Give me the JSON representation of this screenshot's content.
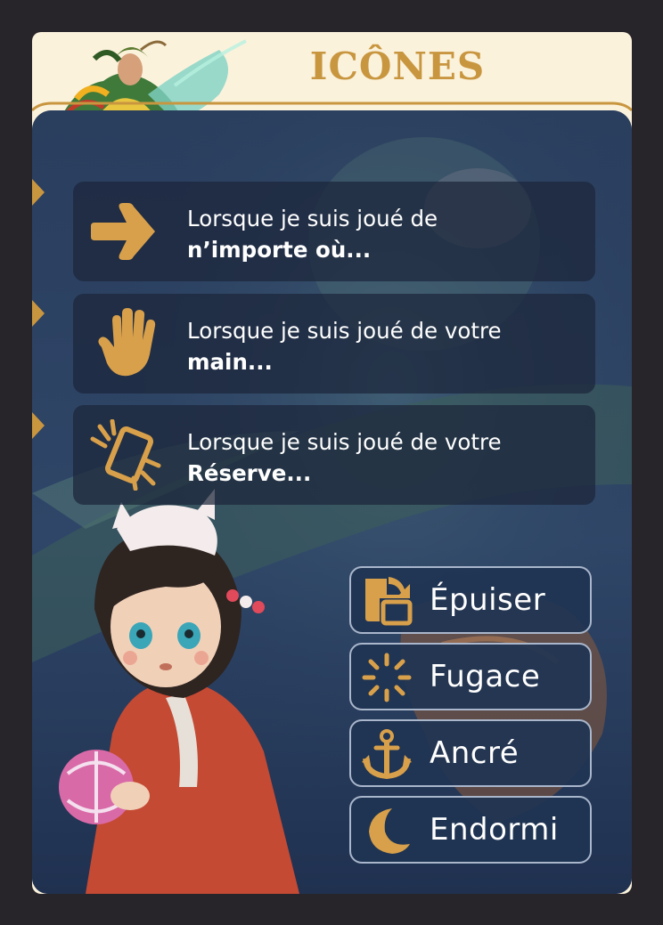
{
  "title": "ICÔNES",
  "colors": {
    "gold": "#c99640",
    "cream": "#fbf2dc",
    "frame": "#28252a",
    "panel": "#2c3d58",
    "box_border": "#a9b6cb"
  },
  "rules": [
    {
      "icon": "arrow-right-icon",
      "text": "Lorsque je suis joué de",
      "bold": "n’importe où..."
    },
    {
      "icon": "hand-icon",
      "text": "Lorsque je suis joué de votre",
      "bold": "main..."
    },
    {
      "icon": "reserve-card-icon",
      "text": "Lorsque je suis joué de votre",
      "bold": "Réserve..."
    }
  ],
  "keywords": [
    {
      "icon": "exhaust-icon",
      "label": "Épuiser"
    },
    {
      "icon": "ephemeral-icon",
      "label": "Fugace"
    },
    {
      "icon": "anchor-icon",
      "label": "Ancré"
    },
    {
      "icon": "moon-icon",
      "label": "Endormi"
    }
  ]
}
